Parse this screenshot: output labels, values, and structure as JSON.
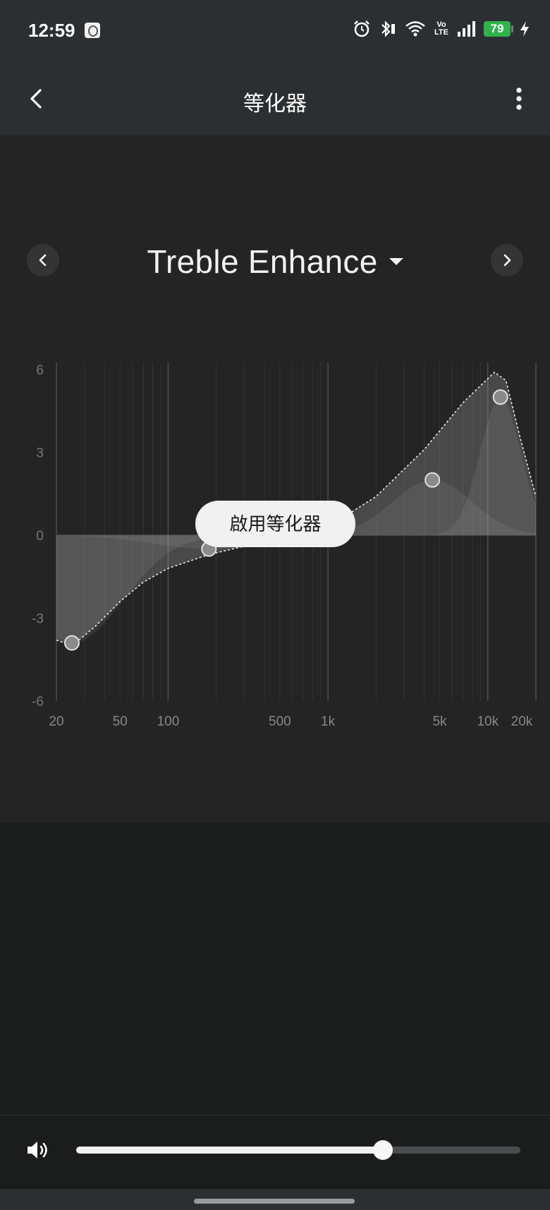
{
  "status_bar": {
    "time": "12:59",
    "icons": [
      "app-icon",
      "alarm-icon",
      "bluetooth-icon",
      "wifi-icon",
      "volte-icon",
      "signal-icon",
      "battery-icon",
      "charging-icon"
    ],
    "volte_line1": "Vo",
    "volte_line2": "LTE",
    "battery_level": "79",
    "battery_color": "#2fb34a"
  },
  "app_bar": {
    "title": "等化器",
    "back_icon": "chevron-left-icon",
    "menu_icon": "more-vertical-icon"
  },
  "preset": {
    "name": "Treble Enhance",
    "prev_icon": "chevron-left-icon",
    "next_icon": "chevron-right-icon",
    "dropdown_icon": "caret-down-icon"
  },
  "chart_data": {
    "type": "line",
    "xscale": "log",
    "xlim": [
      20,
      20000
    ],
    "ylim": [
      -6,
      6
    ],
    "y_ticks": [
      "6",
      "3",
      "0",
      "-3",
      "-6"
    ],
    "x_ticks": [
      "20",
      "50",
      "100",
      "500",
      "1k",
      "5k",
      "10k",
      "20k"
    ],
    "xlabel": "",
    "ylabel": "",
    "bands": [
      {
        "freq": 25,
        "gain": -3.9
      },
      {
        "freq": 180,
        "gain": -0.5
      },
      {
        "freq": 4500,
        "gain": 2.0
      },
      {
        "freq": 12000,
        "gain": 5.0
      }
    ],
    "curve": [
      {
        "freq": 20,
        "gain": -3.8
      },
      {
        "freq": 25,
        "gain": -4.0
      },
      {
        "freq": 35,
        "gain": -3.3
      },
      {
        "freq": 50,
        "gain": -2.4
      },
      {
        "freq": 70,
        "gain": -1.7
      },
      {
        "freq": 100,
        "gain": -1.2
      },
      {
        "freq": 180,
        "gain": -0.7
      },
      {
        "freq": 300,
        "gain": -0.4
      },
      {
        "freq": 600,
        "gain": -0.1
      },
      {
        "freq": 1000,
        "gain": 0.3
      },
      {
        "freq": 2000,
        "gain": 1.4
      },
      {
        "freq": 4000,
        "gain": 3.1
      },
      {
        "freq": 7000,
        "gain": 4.8
      },
      {
        "freq": 11000,
        "gain": 5.9
      },
      {
        "freq": 13000,
        "gain": 5.6
      },
      {
        "freq": 16000,
        "gain": 3.5
      },
      {
        "freq": 20000,
        "gain": 1.4
      }
    ],
    "grid": true,
    "accent_color": "#ffffff"
  },
  "enable_button": {
    "label": "啟用等化器"
  },
  "volume": {
    "icon": "speaker-icon",
    "level": 0.69
  }
}
